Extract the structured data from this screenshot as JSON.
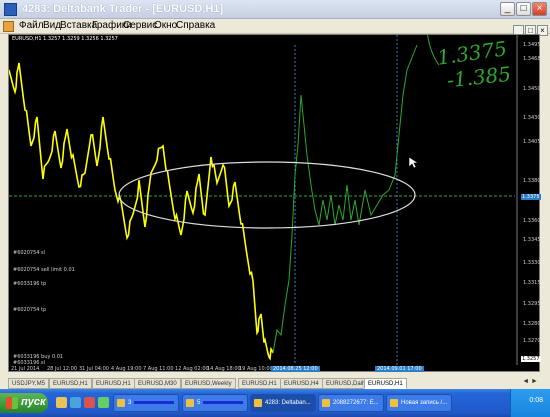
{
  "window": {
    "title": "4283: Deltabank Trader - [EURUSD,H1]",
    "minimize": "_",
    "maximize": "□",
    "close": "×"
  },
  "menu": {
    "items": [
      "Файл",
      "Вид",
      "Вставка",
      "Графики",
      "Сервис",
      "Окно",
      "Справка"
    ],
    "mdi_minimize": "_",
    "mdi_restore": "□",
    "mdi_close": "×"
  },
  "chart": {
    "info": "EURUSD,H1  1.3257 1.3259 1.3256 1.3257",
    "price_ticks": [
      "1.3495",
      "1.3468",
      "1.3450",
      "1.3430",
      "1.3405",
      "1.3380",
      "1.3360",
      "1.3345",
      "1.3330",
      "1.3315",
      "1.3295",
      "1.3280",
      "1.3270"
    ],
    "current_price": "1.3257",
    "highlight_price": "1.3375",
    "time_ticks": [
      "21 Jul 2014",
      "28 Jul 12:00",
      "31 Jul 04:00",
      "4 Aug 19:00",
      "7 Aug 11:00",
      "12 Aug 02:00",
      "14 Aug 18:00",
      "19 Aug 10:00"
    ],
    "time_highlights": [
      "2014.08.25 12:00",
      "2014.09.01 17:00"
    ],
    "order_labels": [
      "#6020754 sl",
      "#6020754 sell limit 0.01",
      "#6033196 tp",
      "#6020754 tp",
      "#6033196 buy 0.01",
      "#6033196 sl"
    ],
    "annotation_1": "1.3375",
    "annotation_2": "1.385"
  },
  "chart_data": {
    "type": "line",
    "symbol": "EURUSD",
    "timeframe": "H1",
    "colors": {
      "price": "#ffff00",
      "drawing": "#2ea82e",
      "ellipse": "#dddddd",
      "grid": "#2b7fc9"
    }
  },
  "tabs": {
    "items": [
      "USDJPY,M5",
      "EURUSD,H1",
      "EURUSD,H1",
      "EURUSD,M30",
      "EURUSD,Weekly",
      "EURUSD,H1",
      "EURUSD,H4",
      "EURUSD,Daily",
      "EURUSD,H1"
    ],
    "active_index": 8,
    "scroll": "◄ ►"
  },
  "taskbar": {
    "start_label": "пуск",
    "tasks": [
      "3",
      "5",
      "4283: Deltaban...",
      "2088272677: E...",
      "Новая запись /..."
    ],
    "clock": "0:08"
  }
}
